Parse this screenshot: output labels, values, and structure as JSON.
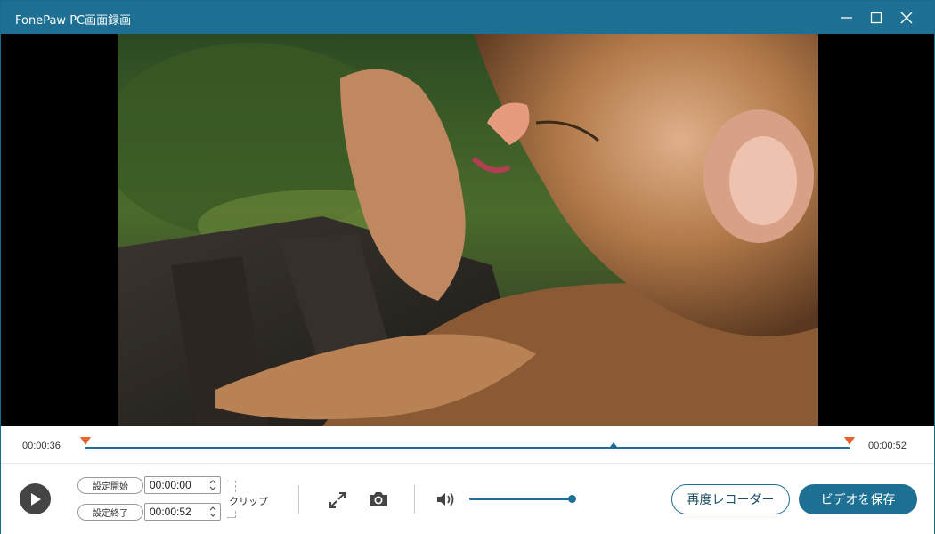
{
  "window": {
    "title": "FonePaw PC画面録画"
  },
  "timeline": {
    "current_time": "00:00:36",
    "total_time": "00:00:52"
  },
  "controls": {
    "set_start_label": "設定開始",
    "set_end_label": "設定終了",
    "start_time_value": "00:00:00",
    "end_time_value": "00:00:52",
    "clip_label": "クリップ",
    "volume_level": 1.0,
    "re_record_label": "再度レコーダー",
    "save_video_label": "ビデオを保存"
  },
  "icons": {
    "minimize": "minimize-icon",
    "maximize": "maximize-icon",
    "close": "close-icon",
    "play": "play-icon",
    "fullscreen": "fullscreen-icon",
    "camera": "camera-icon",
    "volume": "volume-icon"
  },
  "colors": {
    "accent": "#1d6f93",
    "marker": "#e8642c"
  }
}
